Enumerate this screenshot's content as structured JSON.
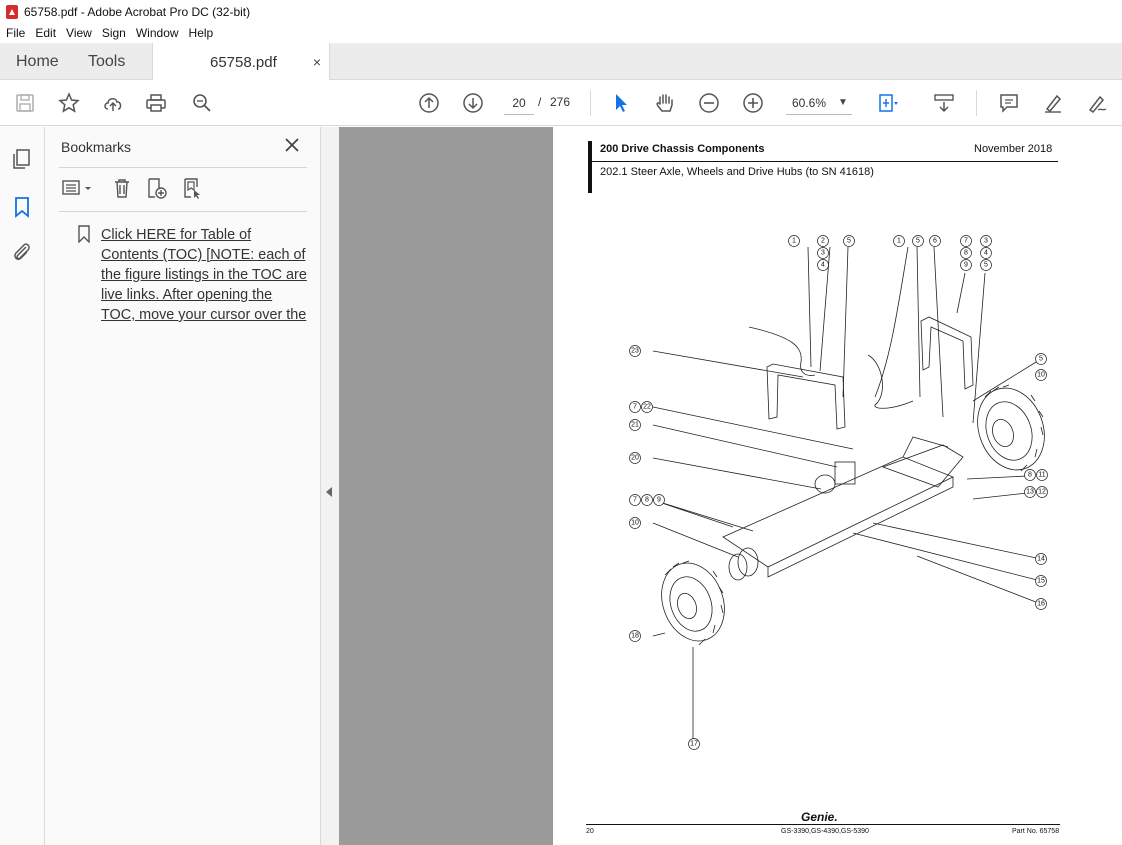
{
  "window": {
    "title": "65758.pdf - Adobe Acrobat Pro DC (32-bit)"
  },
  "menu": [
    "File",
    "Edit",
    "View",
    "Sign",
    "Window",
    "Help"
  ],
  "tabs": {
    "home": "Home",
    "tools": "Tools",
    "document": "65758.pdf",
    "close": "×"
  },
  "toolbar": {
    "page_current": "20",
    "page_sep": "/",
    "page_total": "276",
    "zoom": "60.6%"
  },
  "bookmarks": {
    "title": "Bookmarks",
    "item": "Click HERE for Table of \nContents (TOC) [NOTE: each of \nthe figure listings in the TOC are \nlive links. After opening the \nTOC, move your cursor over the "
  },
  "page": {
    "section": "200 Drive Chassis Components",
    "date": "November 2018",
    "subtitle": "202.1 Steer Axle, Wheels and Drive Hubs (to SN 41618)",
    "logo": "Genie.",
    "footer_page": "20",
    "footer_models": "GS-3390,GS-4390,GS-5390",
    "footer_part": "Part No. 65758"
  },
  "callouts": [
    "1",
    "2",
    "3",
    "4",
    "5",
    "1",
    "5",
    "6",
    "7",
    "8",
    "9",
    "3",
    "4",
    "5",
    "23",
    "5",
    "10",
    "7",
    "22",
    "21",
    "20",
    "8",
    "11",
    "13",
    "12",
    "7",
    "8",
    "9",
    "10",
    "14",
    "15",
    "16",
    "18",
    "17"
  ]
}
